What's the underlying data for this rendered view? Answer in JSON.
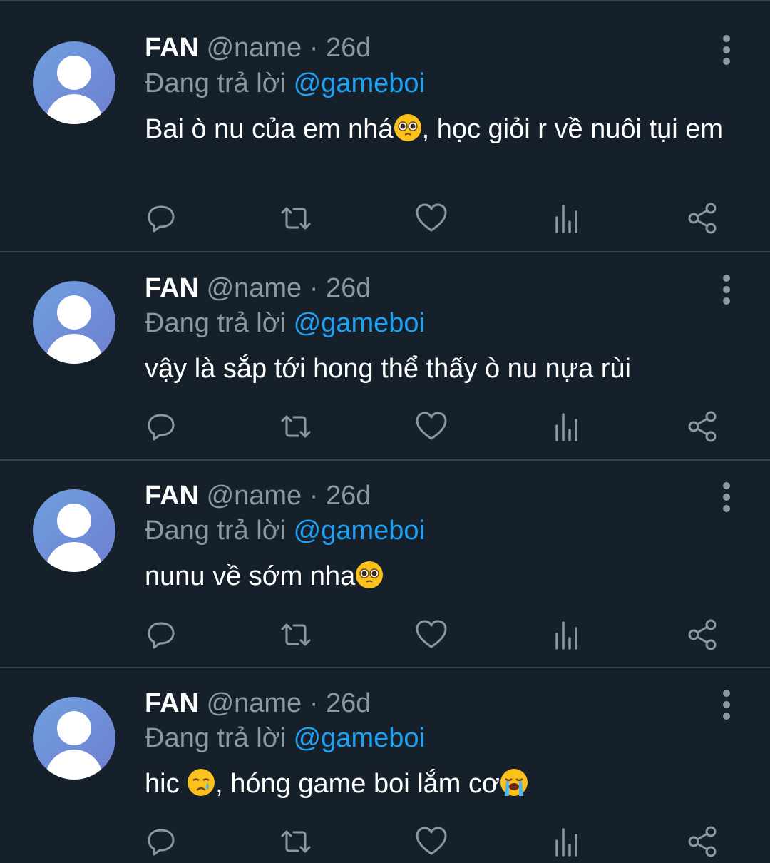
{
  "tweets": [
    {
      "name": "FAN",
      "handle": "@name",
      "separator": "·",
      "time": "26d",
      "reply_prefix": "Đang trả lời",
      "reply_to": "@gameboi",
      "text_parts": [
        "Bai ò nu của em nhá",
        "pleading-face-emoji",
        ", học giỏi r về nuôi tụi em"
      ]
    },
    {
      "name": "FAN",
      "handle": "@name",
      "separator": "·",
      "time": "26d",
      "reply_prefix": "Đang trả lời",
      "reply_to": "@gameboi",
      "text_parts": [
        "vậy là sắp tới hong thể thấy ò nu nựa rùi"
      ]
    },
    {
      "name": "FAN",
      "handle": "@name",
      "separator": "·",
      "time": "26d",
      "reply_prefix": "Đang trả lời",
      "reply_to": "@gameboi",
      "text_parts": [
        "nunu về sớm nha",
        "pleading-face-emoji"
      ]
    },
    {
      "name": "FAN",
      "handle": "@name",
      "separator": "·",
      "time": "26d",
      "reply_prefix": "Đang trả lời",
      "reply_to": "@gameboi",
      "text_parts": [
        "hic ",
        "crying-face-emoji",
        ", hóng game boi lắm cơ",
        "loudly-crying-face-emoji"
      ]
    }
  ],
  "actions": [
    "reply-icon",
    "retweet-icon",
    "like-icon",
    "analytics-icon",
    "share-icon"
  ],
  "colors": {
    "background": "#15202b",
    "divider": "#38444d",
    "secondary_text": "#8899a6",
    "accent": "#1da1f2",
    "icon": "#8899a6"
  }
}
